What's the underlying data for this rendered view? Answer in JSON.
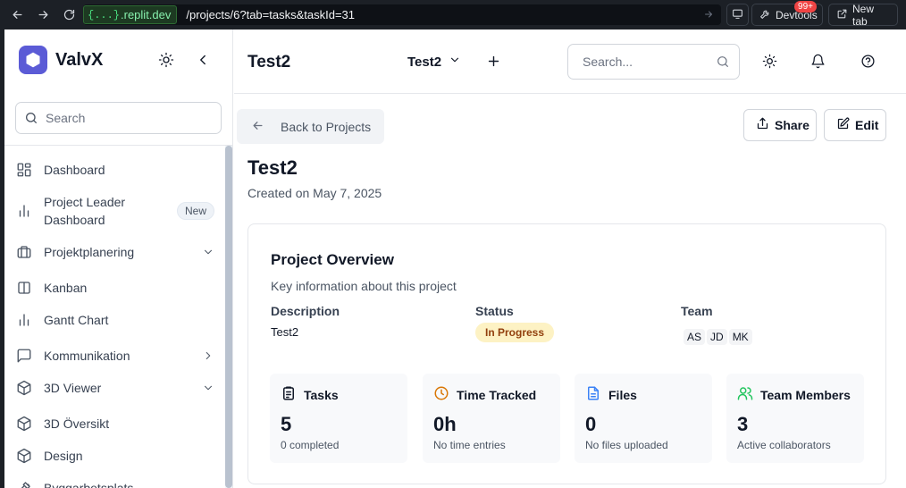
{
  "browser": {
    "url_badge": "{...}",
    "url_domain": ".replit.dev",
    "url_path": "/projects/6?tab=tasks&taskId=31",
    "devtools_label": "Devtools",
    "devtools_badge": "99+",
    "newtab_label": "New tab"
  },
  "sidebar": {
    "brand": "ValvX",
    "search_placeholder": "Search",
    "items": [
      {
        "label": "Dashboard",
        "icon": "layout-grid-icon"
      },
      {
        "label": "Project Leader Dashboard",
        "icon": "bar-chart-icon",
        "badge": "New"
      },
      {
        "label": "Projektplanering",
        "icon": "briefcase-icon",
        "chevron": "down"
      },
      {
        "label": "Kanban",
        "icon": "columns-icon"
      },
      {
        "label": "Gantt Chart",
        "icon": "bar-chart-icon"
      },
      {
        "label": "Kommunikation",
        "icon": "message-square-icon",
        "chevron": "right"
      },
      {
        "label": "3D Viewer",
        "icon": "box-icon",
        "chevron": "down"
      },
      {
        "label": "3D Översikt",
        "icon": "box-icon"
      },
      {
        "label": "Design",
        "icon": "box-icon"
      },
      {
        "label": "Byggarbetsplats",
        "icon": "hammer-icon"
      }
    ]
  },
  "header": {
    "title": "Test2",
    "project_selector": "Test2",
    "search_placeholder": "Search..."
  },
  "main": {
    "back_label": "Back to Projects",
    "share_label": "Share",
    "edit_label": "Edit",
    "title": "Test2",
    "created": "Created on May 7, 2025",
    "overview": {
      "title": "Project Overview",
      "subtitle": "Key information about this project",
      "description_label": "Description",
      "description_value": "Test2",
      "status_label": "Status",
      "status_value": "In Progress",
      "team_label": "Team",
      "team": [
        "AS",
        "JD",
        "MK"
      ]
    },
    "stats": [
      {
        "label": "Tasks",
        "value": "5",
        "sub": "0 completed",
        "icon": "clipboard-list-icon",
        "color": "#111827"
      },
      {
        "label": "Time Tracked",
        "value": "0h",
        "sub": "No time entries",
        "icon": "clock-icon",
        "color": "#d97706"
      },
      {
        "label": "Files",
        "value": "0",
        "sub": "No files uploaded",
        "icon": "file-text-icon",
        "color": "#3b82f6"
      },
      {
        "label": "Team Members",
        "value": "3",
        "sub": "Active collaborators",
        "icon": "users-icon",
        "color": "#22c55e"
      }
    ]
  },
  "colors": {
    "brand": "#5b5bd6",
    "status_bg": "#fdf2c4",
    "status_text": "#92400e"
  }
}
